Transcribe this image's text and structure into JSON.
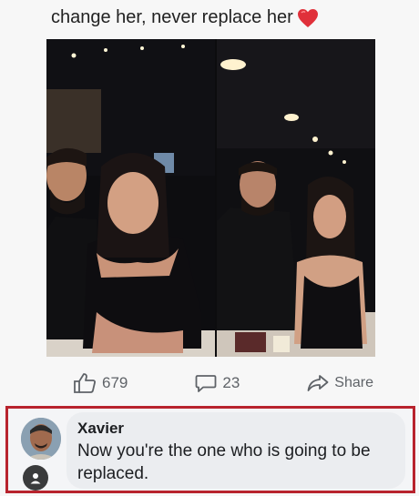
{
  "post": {
    "caption": "change her, never replace her",
    "heart_emoji": "heart-emoji",
    "likes": "679",
    "comments": "23",
    "share_label": "Share"
  },
  "comment": {
    "author": "Xavier",
    "text": "Now you're the one who is going to be replaced."
  },
  "colors": {
    "highlight_border": "#b8232d",
    "heart": "#e0303a",
    "icon_gray": "#5f6368"
  }
}
